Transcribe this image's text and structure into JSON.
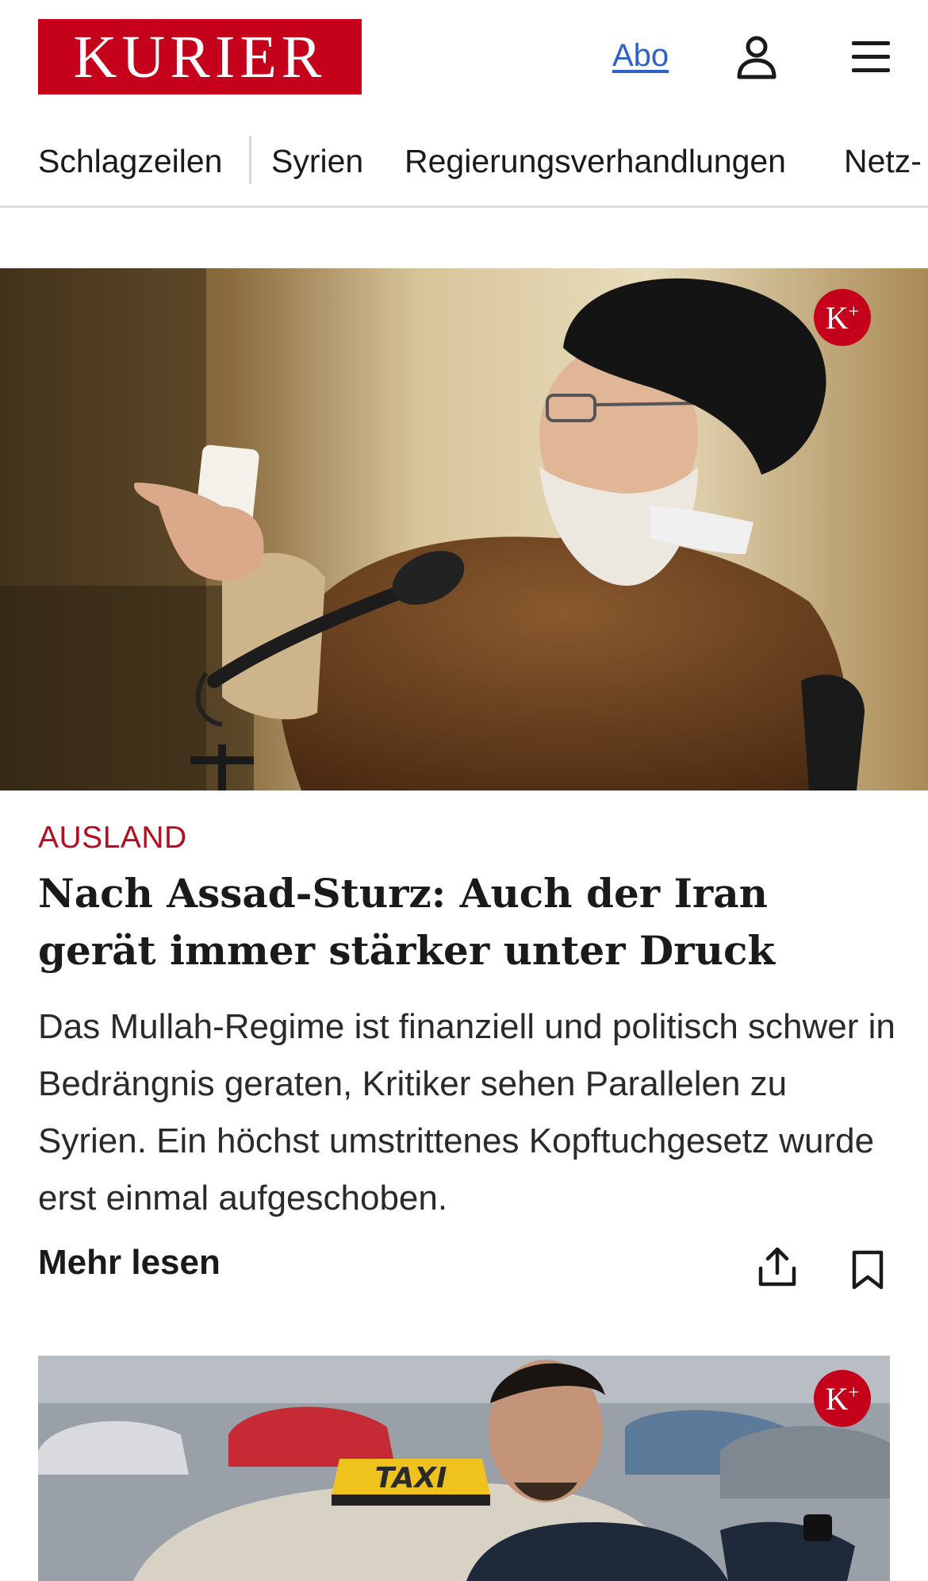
{
  "header": {
    "logo_text": "KURIER",
    "abo_label": "Abo",
    "user_icon": "user-icon",
    "menu_icon": "hamburger-menu-icon"
  },
  "nav": {
    "items": [
      "Schlagzeilen",
      "Syrien",
      "Regierungsverhandlungen",
      "Netz-"
    ]
  },
  "article1": {
    "premium_badge": "K",
    "kicker": "AUSLAND",
    "headline": "Nach Assad-Sturz: Auch der Iran gerät immer stärker unter Druck",
    "teaser": "Das Mullah-Regime ist finanziell und politisch schwer in Bedrängnis geraten, Kritiker sehen Parallelen zu Syrien. Ein höchst umstrittenes Kopftuchgesetz wurde erst einmal aufgeschoben.",
    "more_label": "Mehr lesen",
    "share_icon": "share-icon",
    "bookmark_icon": "bookmark-icon"
  },
  "article2": {
    "premium_badge": "K",
    "taxi_sign": "TAXI"
  },
  "colors": {
    "brand_red": "#c4001a",
    "kicker_red": "#b30f1e",
    "link_blue": "#2f62c9"
  }
}
